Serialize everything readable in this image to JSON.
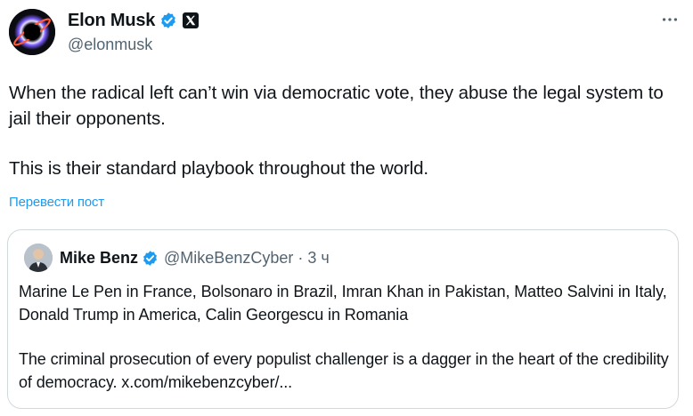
{
  "author": {
    "name": "Elon Musk",
    "handle": "@elonmusk",
    "avatar_icon": "black-hole-avatar",
    "verified_icon": "verified-badge-icon",
    "affiliation_icon": "x-logo-icon"
  },
  "more_icon": "more-options-icon",
  "tweet": {
    "paragraphs": [
      "When the radical left can’t win via democratic vote, they abuse the legal system to jail their opponents.",
      "This is their standard playbook throughout the world."
    ],
    "translate_label": "Перевести пост"
  },
  "quote": {
    "name": "Mike Benz",
    "handle": "@MikeBenzCyber",
    "separator": "·",
    "time": "3 ч",
    "paragraphs": [
      "Marine Le Pen in France, Bolsonaro in Brazil, Imran Khan in Pakistan, Matteo Salvini in Italy, Donald Trump in America, Calin Georgescu in Romania",
      "The criminal prosecution of every populist challenger is a dagger in the heart of the credibility of democracy. x.com/mikebenzcyber/..."
    ]
  },
  "colors": {
    "text": "#0f1419",
    "secondary": "#536471",
    "link": "#1d9bf0",
    "verified": "#1d9bf0",
    "border": "#cfd9de"
  }
}
